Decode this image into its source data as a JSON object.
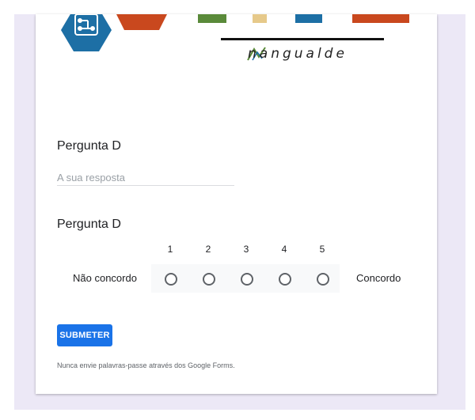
{
  "banner": {
    "brand_text": "nangualde"
  },
  "question1": {
    "title": "Pergunta D",
    "placeholder": "A sua resposta"
  },
  "question2": {
    "title": "Pergunta D",
    "scale": [
      1,
      2,
      3,
      4,
      5
    ],
    "min_label": "Não concordo",
    "max_label": "Concordo"
  },
  "form": {
    "submit_label": "SUBMETER",
    "footnote": "Nunca envie palavras-passe através dos Google Forms."
  },
  "colors": {
    "accent": "#1a73e8",
    "hex_blue": "#1d6fa5",
    "orange": "#c9481e",
    "green": "#5a8a3a",
    "sand": "#e6c98a"
  }
}
